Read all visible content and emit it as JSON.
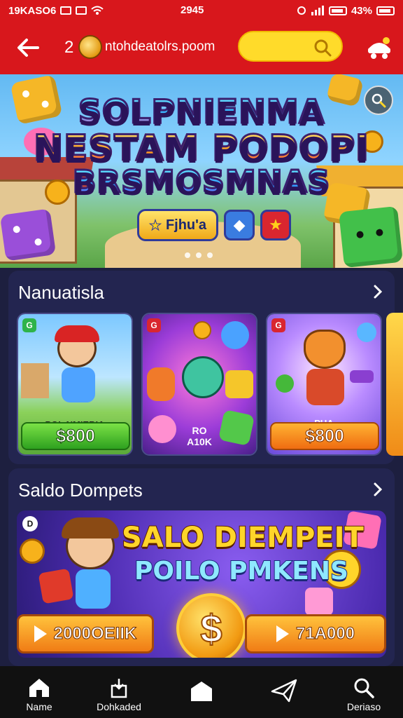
{
  "status_bar": {
    "left_text": "19KASO6",
    "time": "2945",
    "right_text": "43%"
  },
  "header": {
    "count": "2",
    "url": "ntohdeatolrs.poom",
    "search_placeholder": ""
  },
  "banner": {
    "title_lines": [
      "SOLPNIENMA",
      "NESTAM PODOPI",
      "BRSMOSMNAS"
    ],
    "badge_label": "Fjhu'a",
    "page_indicator": {
      "count": 3,
      "active": 0
    }
  },
  "section_1": {
    "title": "Nanuatisla",
    "cards": [
      {
        "subtitle": "POL NMIEBIA",
        "price": "$800",
        "price_style": "green"
      },
      {
        "subtitle": "RO\nA10K",
        "price": "",
        "price_style": "none"
      },
      {
        "subtitle": "PUA",
        "price": "$800",
        "price_style": "orange"
      }
    ]
  },
  "section_2": {
    "title": "Saldo Dompets",
    "promo": {
      "line_1": "SALO DIEMPEIT",
      "line_2": "POILO PMKENS",
      "button_left": "2000OEIIK",
      "button_right": "71A000",
      "coin_symbol": "$"
    }
  },
  "bottom_nav": [
    {
      "label": "Name",
      "icon": "home-icon"
    },
    {
      "label": "Dohkaded",
      "icon": "download-icon"
    },
    {
      "label": "",
      "icon": "house-center-icon"
    },
    {
      "label": "",
      "icon": "send-icon"
    },
    {
      "label": "Deriaso",
      "icon": "search-icon"
    }
  ],
  "colors": {
    "header_red": "#d8171c",
    "search_yellow": "#ffdb2a",
    "page_bg": "#1d1f3f",
    "nav_bg": "#111111"
  }
}
